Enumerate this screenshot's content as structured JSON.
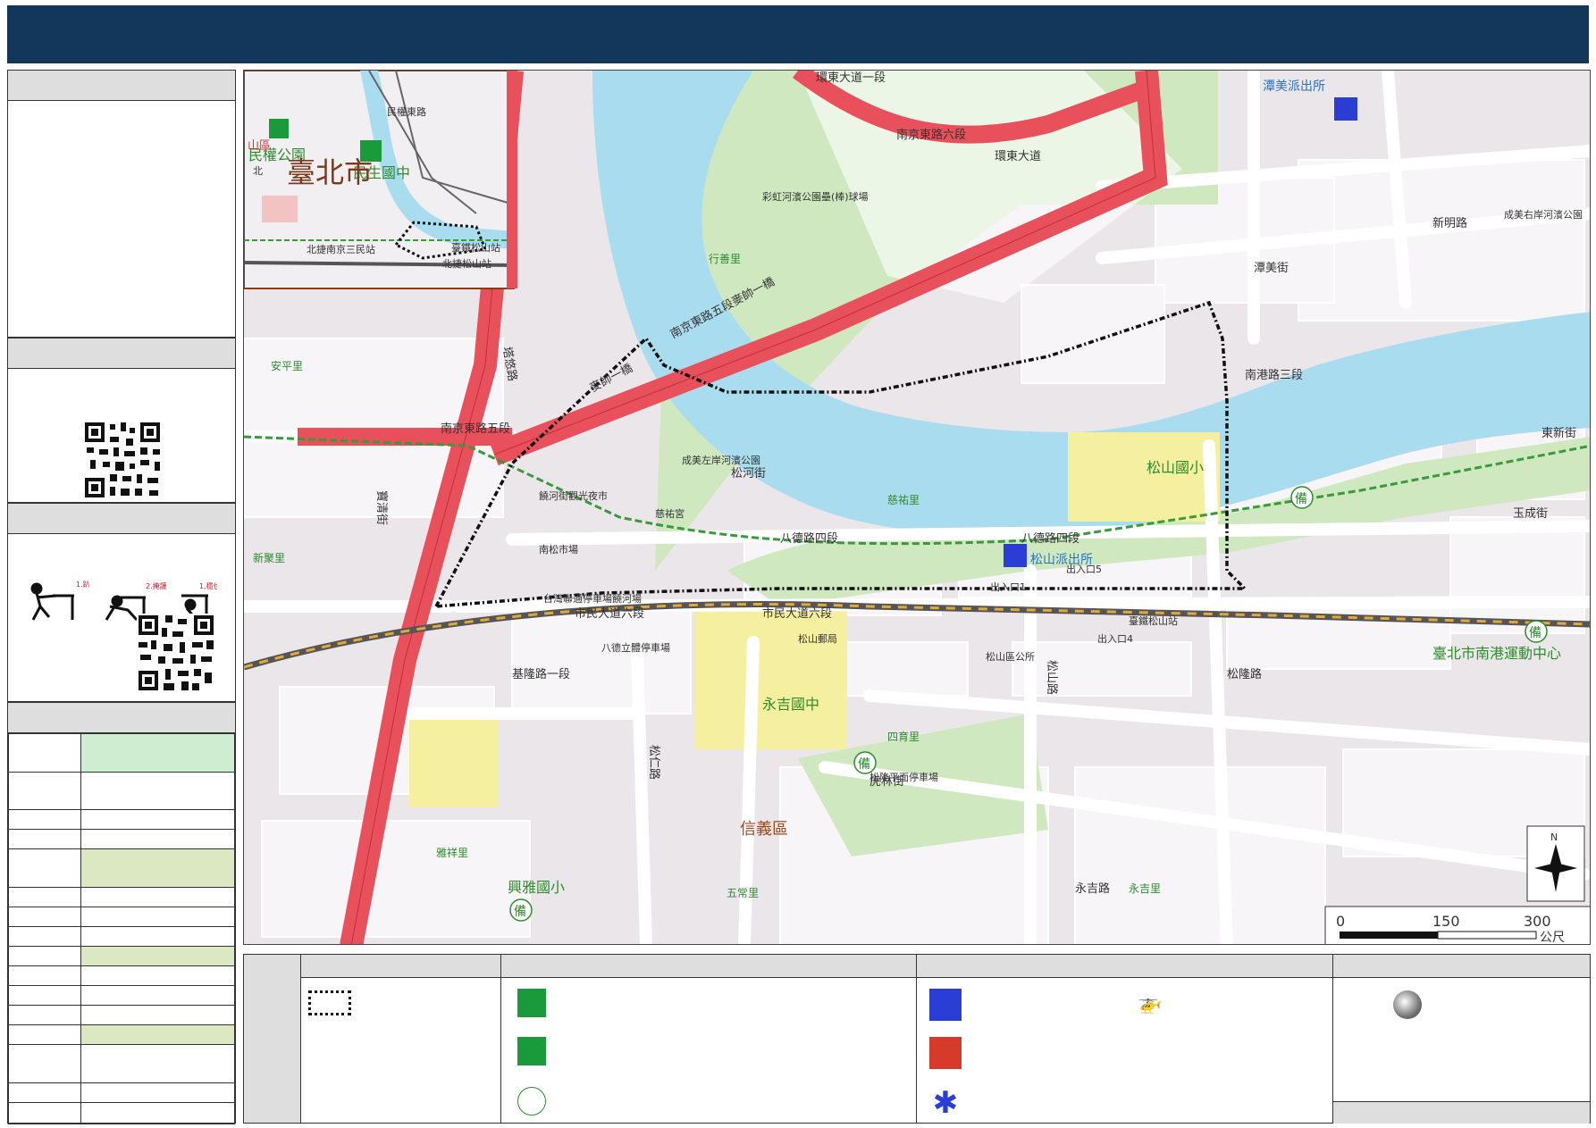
{
  "map": {
    "inset_labels": {
      "park": "民權公園",
      "school": "民生國中",
      "city": "臺北市",
      "road1": "民權東路",
      "station1": "北捷南京三民站",
      "station2": "臺鐵松山站",
      "station3": "北捷松山站",
      "district": "山區",
      "north": "北"
    },
    "road_labels": {
      "nanjing6": "南京東路六段",
      "huandong1": "環東大道一段",
      "huandong": "環東大道",
      "nanjing5": "南京東路五段",
      "nanjing5_bridge": "南京東路五段麥帥一橋",
      "maishi": "麥帥一橋",
      "bade4": "八德路四段",
      "shimin6": "市民大道六段",
      "keelung1": "基隆路一段",
      "nangang3": "南港路三段",
      "songhe": "松河街",
      "songshan": "松山路",
      "hulin": "虎林街",
      "yongji": "永吉路",
      "songlong": "松隆路",
      "xinming": "新明路",
      "tanmei": "潭美街",
      "baoqing": "寶清街",
      "tangxi": "塔悠路",
      "yucheng": "玉成街",
      "dongxin": "東新街",
      "songren": "松仁路"
    },
    "place_labels": {
      "tanmei_police": "潭美派出所",
      "songshan_police": "松山派出所",
      "songshan_elem": "松山國小",
      "yongji_junior": "永吉國中",
      "xingya_elem": "興雅國小",
      "nangang_sports": "臺北市南港運動中心",
      "xinyi": "信義區",
      "rainbow_park": "彩虹河濱公園壘(棒)球場",
      "chengmei_park": "成美左岸河濱公園",
      "chengmei_right": "成美右岸河濱公園",
      "raohe_night": "饒河街觀光夜市",
      "songshan_station": "臺鐵松山站",
      "ciyou": "慈祐宮",
      "xingshan": "行善里",
      "cihui": "慈祐里",
      "yongji_li": "永吉里",
      "wuchang": "五常里",
      "siyu": "四育里",
      "xinju": "新聚里",
      "anping": "安平里",
      "yaxiang": "雅祥里",
      "xingxiang": "慈祐里",
      "entrance5": "出入口5",
      "entrance4": "出入口4",
      "entrance1": "出入口1",
      "songshan_district": "松山區公所",
      "post": "松山郵局",
      "parking1": "南松市場",
      "parking2": "八德立體停車場",
      "parking3": "松隆平面停車場",
      "parking4": "台灣聯通停車場饒河場",
      "bei": "備"
    },
    "scale": {
      "t0": "0",
      "t1": "150",
      "t2": "300",
      "unit": "公尺"
    },
    "compass": "N"
  },
  "colors": {
    "header": "#12375a",
    "river": "#a9dcee",
    "park": "#cfe8c0",
    "road_major": "#e8505b",
    "block": "#f6f4f6",
    "school": "#f5f0a0"
  },
  "icons": {
    "legend_boundary": "dotted-boundary-icon",
    "legend_shelter": "shelter-icon",
    "legend_evac": "evacuation-icon",
    "legend_backup": "backup-icon",
    "legend_police": "police-icon",
    "legend_fire": "fire-icon",
    "legend_medical": "medical-icon",
    "legend_helicopter": "helicopter-icon",
    "legend_point": "point-icon"
  }
}
